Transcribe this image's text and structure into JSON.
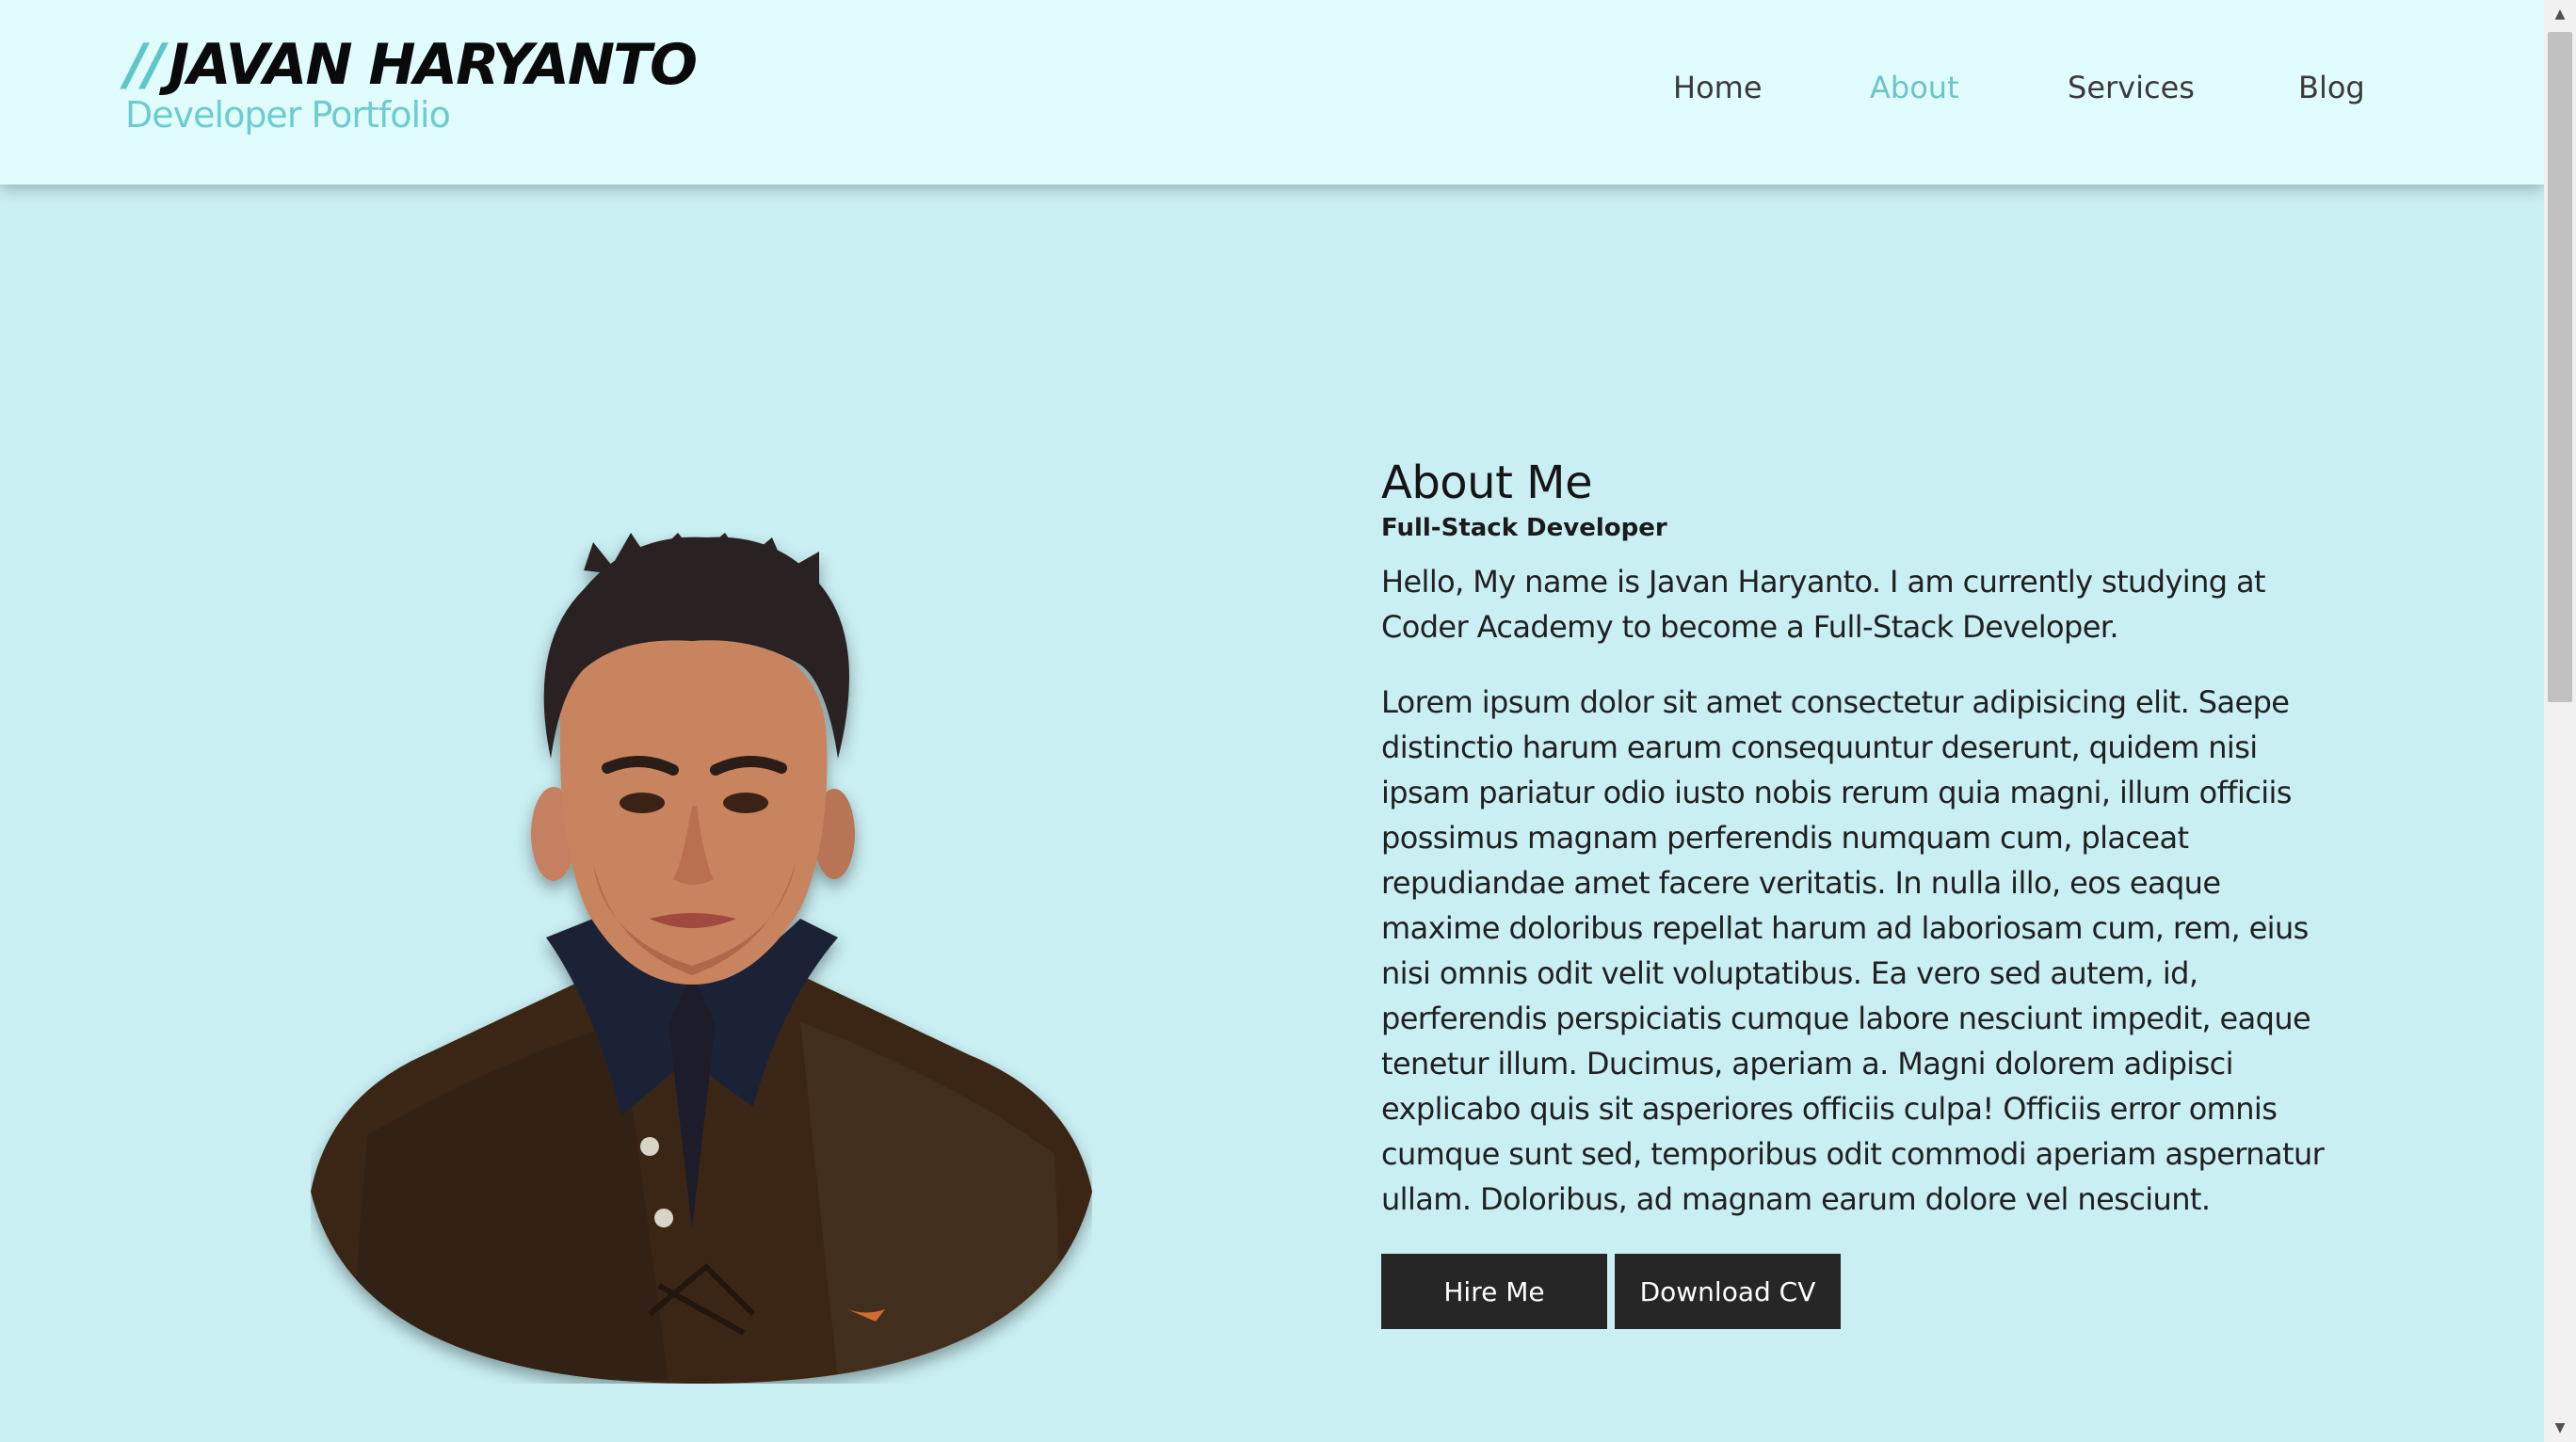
{
  "header": {
    "brand_slash": "//",
    "brand_name": "JAVAN HARYANTO",
    "brand_tagline": "Developer Portfolio",
    "nav": [
      {
        "label": "Home",
        "active": false
      },
      {
        "label": "About",
        "active": true
      },
      {
        "label": "Services",
        "active": false
      },
      {
        "label": "Blog",
        "active": false
      }
    ]
  },
  "about": {
    "title": "About Me",
    "subtitle": "Full-Stack Developer",
    "intro": "Hello, My name is Javan Haryanto. I am currently studying at Coder Academy to become a Full-Stack Developer.",
    "body": "Lorem ipsum dolor sit amet consectetur adipisicing elit. Saepe distinctio harum earum consequuntur deserunt, quidem nisi ipsam pariatur odio iusto nobis rerum quia magni, illum officiis possimus magnam perferendis numquam cum, placeat repudiandae amet facere veritatis. In nulla illo, eos eaque maxime doloribus repellat harum ad laboriosam cum, rem, eius nisi omnis odit velit voluptatibus. Ea vero sed autem, id, perferendis perspiciatis cumque labore nesciunt impedit, eaque tenetur illum. Ducimus, aperiam a. Magni dolorem adipisci explicabo quis sit asperiores officiis culpa! Officiis error omnis cumque sunt sed, temporibus odit commodi aperiam aspernatur ullam. Doloribus, ad magnam earum dolore vel nesciunt.",
    "hire_label": "Hire Me",
    "cv_label": "Download CV"
  },
  "colors": {
    "page_bg": "#c9eff3",
    "header_bg": "#e1fcfd",
    "accent": "#6cc4c7",
    "button_bg": "#262626"
  },
  "icons": {
    "scroll_up": "triangle-up-icon",
    "scroll_down": "triangle-down-icon"
  }
}
